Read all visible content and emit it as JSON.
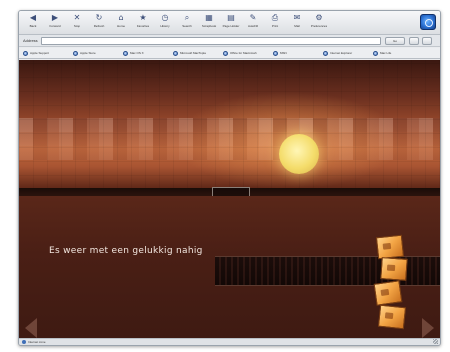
{
  "toolbar": {
    "buttons": [
      {
        "icon": "back-icon",
        "glyph": "◀",
        "label": "Back"
      },
      {
        "icon": "forward-icon",
        "glyph": "▶",
        "label": "Forward"
      },
      {
        "icon": "stop-icon",
        "glyph": "✕",
        "label": "Stop"
      },
      {
        "icon": "refresh-icon",
        "glyph": "↻",
        "label": "Refresh"
      },
      {
        "icon": "home-icon",
        "glyph": "⌂",
        "label": "Home"
      },
      {
        "icon": "favorites-icon",
        "glyph": "★",
        "label": "Favorites"
      },
      {
        "icon": "history-icon",
        "glyph": "◷",
        "label": "History"
      },
      {
        "icon": "search-icon",
        "glyph": "⌕",
        "label": "Search"
      },
      {
        "icon": "scrapbook-icon",
        "glyph": "▦",
        "label": "Scrapbook"
      },
      {
        "icon": "page-holder-icon",
        "glyph": "▤",
        "label": "Page Holder"
      },
      {
        "icon": "autofill-icon",
        "glyph": "✎",
        "label": "AutoFill"
      },
      {
        "icon": "print-icon",
        "glyph": "⎙",
        "label": "Print"
      },
      {
        "icon": "mail-icon",
        "glyph": "✉",
        "label": "Mail"
      },
      {
        "icon": "preferences-icon",
        "glyph": "⚙",
        "label": "Preferences"
      }
    ]
  },
  "address": {
    "label": "Address",
    "value": "",
    "go_label": "Go"
  },
  "favorites": [
    {
      "label": "Apple Support"
    },
    {
      "label": "Apple Store"
    },
    {
      "label": "Mac OS X"
    },
    {
      "label": "Microsoft MacTopia"
    },
    {
      "label": "Office for Macintosh"
    },
    {
      "label": "MSN"
    },
    {
      "label": "Internet Explorer"
    },
    {
      "label": "Mac Life"
    }
  ],
  "content": {
    "tagline": "Es weer met een gelukkig nahig"
  },
  "statusbar": {
    "text": "Internet zone"
  }
}
